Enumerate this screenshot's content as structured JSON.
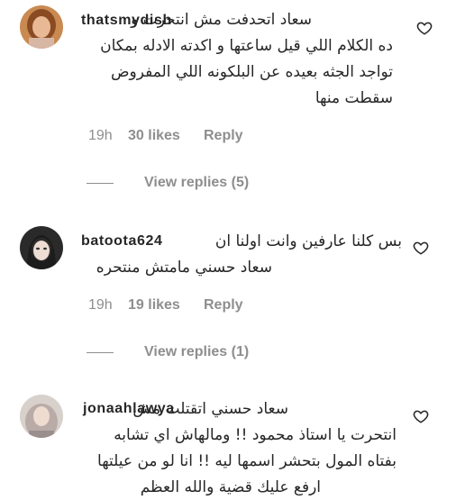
{
  "comments": [
    {
      "username": "thatsmydish",
      "lines": [
        "سعاد اتحدفت مش انتحرت و",
        "ده الكلام اللي قيل ساعتها و اكدته الادله بمكان",
        "تواجد الجثه بعيده عن البلكونه اللي المفروض",
        "سقطت منها"
      ],
      "time": "19h",
      "likes": "30 likes",
      "reply": "Reply",
      "view_replies": "View replies (5)"
    },
    {
      "username": "batoota624",
      "lines": [
        "بس كلنا عارفين وانت اولنا ان",
        "سعاد حسني مامتش منتحره"
      ],
      "time": "19h",
      "likes": "19 likes",
      "reply": "Reply",
      "view_replies": "View replies (1)"
    },
    {
      "username": "jonaahlawya",
      "lines": [
        "سعاد حسني اتقتلت مش",
        "انتحرت يا استاذ محمود !! ومالهاش اي تشابه",
        "بفتاه المول بتحشر اسمها ليه !! انا لو من عيلتها",
        "ارفع عليك قضية والله العظم"
      ]
    }
  ],
  "colors": {
    "text": "#262626",
    "secondary": "#8e8e8e"
  },
  "icons": {
    "like": "heart-outline-icon"
  }
}
